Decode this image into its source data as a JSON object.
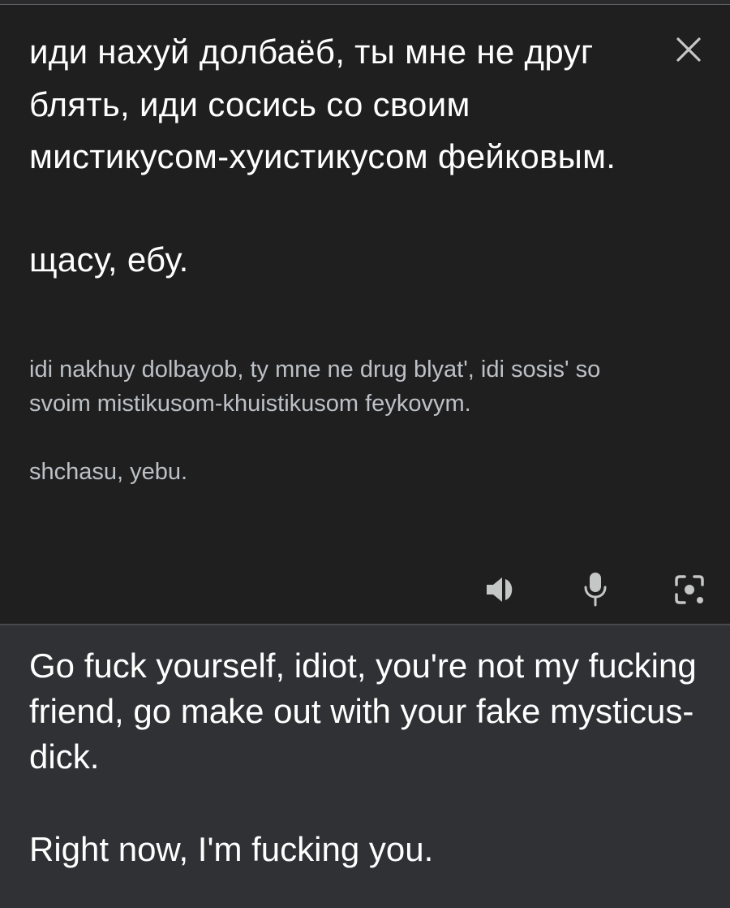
{
  "source": {
    "paragraph_1": "иди нахуй долбаёб, ты мне не друг блять, иди сосись со своим мистикусом-хуистикусом фейковым.",
    "paragraph_2": "щасу, ебу."
  },
  "transliteration": {
    "paragraph_1": "idi nakhuy dolbayob, ty mne ne drug blyat', idi sosis' so svoim mistikusom-khuistikusom feykovym.",
    "paragraph_2": "shchasu, yebu."
  },
  "translation": {
    "paragraph_1": "Go fuck yourself, idiot, you're not my fucking friend, go make out with your fake mysticus-dick.",
    "paragraph_2": "Right now, I'm fucking you."
  },
  "icons": {
    "close": "close-icon",
    "speaker": "speaker-icon",
    "microphone": "microphone-icon",
    "lens": "camera-lens-icon"
  },
  "colors": {
    "source_background": "#1f1f1f",
    "target_background": "#303134",
    "primary_text": "#ffffff",
    "secondary_text": "#bdc1c6",
    "icon": "#c4c7c5"
  }
}
